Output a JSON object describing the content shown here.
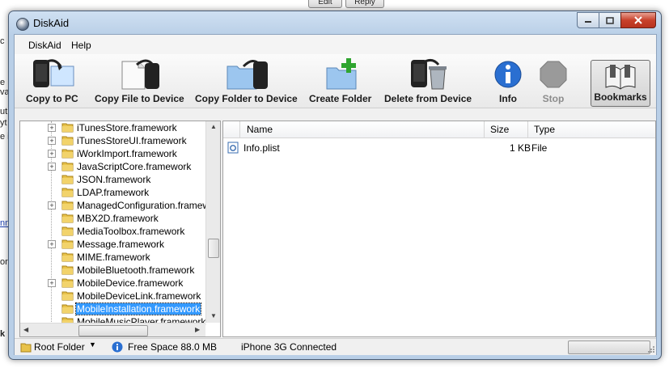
{
  "background": {
    "top_buttons": [
      "Edit",
      "Reply"
    ],
    "left_fragments": [
      "c",
      "e",
      "va",
      "ut",
      "yt",
      "e i",
      "nn",
      "or",
      "k"
    ]
  },
  "window": {
    "title": "DiskAid"
  },
  "menu": {
    "items": [
      "DiskAid",
      "Help"
    ]
  },
  "toolbar": {
    "buttons": [
      {
        "label": "Copy to PC",
        "icon": "copy-to-pc-icon"
      },
      {
        "label": "Copy File to Device",
        "icon": "copy-file-to-device-icon"
      },
      {
        "label": "Copy Folder to Device",
        "icon": "copy-folder-to-device-icon"
      },
      {
        "label": "Create Folder",
        "icon": "create-folder-icon"
      },
      {
        "label": "Delete from Device",
        "icon": "delete-from-device-icon"
      },
      {
        "label": "Info",
        "icon": "info-icon"
      },
      {
        "label": "Stop",
        "icon": "stop-icon"
      },
      {
        "label": "Bookmarks",
        "icon": "bookmarks-icon"
      }
    ]
  },
  "tree": {
    "items": [
      {
        "label": "iTunesStore.framework",
        "expandable": true
      },
      {
        "label": "iTunesStoreUI.framework",
        "expandable": true
      },
      {
        "label": "iWorkImport.framework",
        "expandable": true
      },
      {
        "label": "JavaScriptCore.framework",
        "expandable": true
      },
      {
        "label": "JSON.framework",
        "expandable": false
      },
      {
        "label": "LDAP.framework",
        "expandable": false
      },
      {
        "label": "ManagedConfiguration.framework",
        "expandable": true
      },
      {
        "label": "MBX2D.framework",
        "expandable": false
      },
      {
        "label": "MediaToolbox.framework",
        "expandable": false
      },
      {
        "label": "Message.framework",
        "expandable": true
      },
      {
        "label": "MIME.framework",
        "expandable": false
      },
      {
        "label": "MobileBluetooth.framework",
        "expandable": false
      },
      {
        "label": "MobileDevice.framework",
        "expandable": true
      },
      {
        "label": "MobileDeviceLink.framework",
        "expandable": false
      },
      {
        "label": "MobileInstallation.framework",
        "expandable": false,
        "selected": true
      },
      {
        "label": "MobileMusicPlayer.framework",
        "expandable": false
      }
    ]
  },
  "list": {
    "columns": [
      "Name",
      "Size",
      "Type"
    ],
    "rows": [
      {
        "name": "Info.plist",
        "size": "1 KB",
        "type": "File"
      }
    ]
  },
  "status": {
    "root_folder": "Root Folder",
    "free_space": "Free Space 88.0 MB",
    "connection": "iPhone 3G Connected"
  },
  "colors": {
    "selection": "#3399ff",
    "title_bar": "#b9cfe7",
    "close_button": "#c8412b",
    "info_blue": "#2a6fd1",
    "create_green": "#2fa52f"
  }
}
